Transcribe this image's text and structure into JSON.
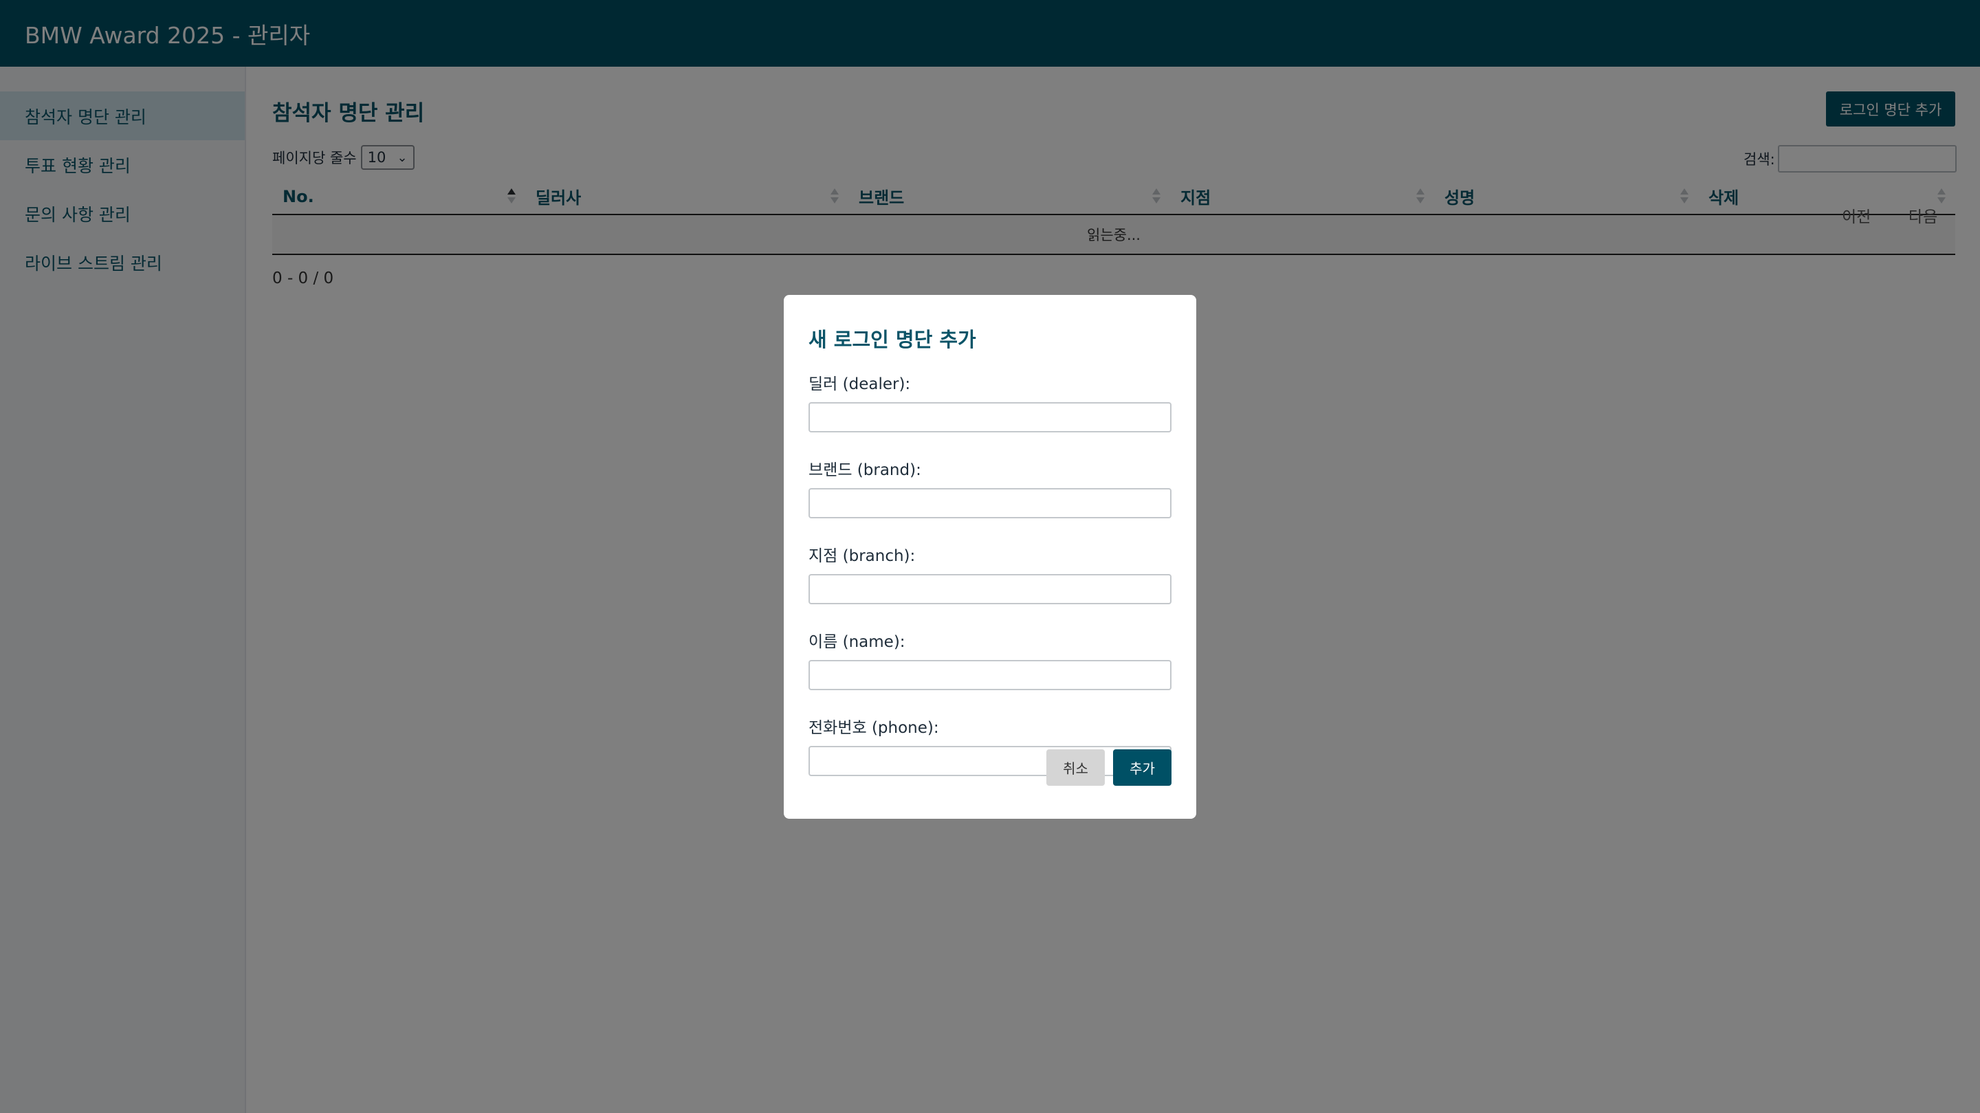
{
  "header": {
    "title": "BMW Award 2025 - 관리자"
  },
  "sidebar": {
    "items": [
      {
        "label": "참석자 명단 관리",
        "active": true
      },
      {
        "label": "투표 현황 관리",
        "active": false
      },
      {
        "label": "문의 사항 관리",
        "active": false
      },
      {
        "label": "라이브 스트림 관리",
        "active": false
      }
    ]
  },
  "main": {
    "page_title": "참석자 명단 관리",
    "add_button_label": "로그인 명단 추가",
    "per_page_label": "페이지당 줄수",
    "per_page_value": "10",
    "search_label": "검색:",
    "search_value": "",
    "table": {
      "columns": [
        "No.",
        "딜러사",
        "브랜드",
        "지점",
        "성명",
        "삭제"
      ],
      "sorted_column": "No.",
      "sort_direction": "asc",
      "loading_text": "읽는중..."
    },
    "info_text": "0 - 0 / 0",
    "pagination": {
      "prev_label": "이전",
      "next_label": "다음"
    }
  },
  "modal": {
    "title": "새 로그인 명단 추가",
    "fields": [
      {
        "label": "딜러 (dealer):",
        "value": ""
      },
      {
        "label": "브랜드 (brand):",
        "value": ""
      },
      {
        "label": "지점 (branch):",
        "value": ""
      },
      {
        "label": "이름 (name):",
        "value": ""
      },
      {
        "label": "전화번호 (phone):",
        "value": ""
      }
    ],
    "cancel_label": "취소",
    "add_label": "추가"
  },
  "colors": {
    "primary": "#005065",
    "active_nav_bg": "#cfe2ea",
    "overlay": "rgba(0,0,0,0.5)"
  },
  "icons": [
    "sort-asc-icon",
    "sort-icon",
    "chevron-down-icon"
  ]
}
